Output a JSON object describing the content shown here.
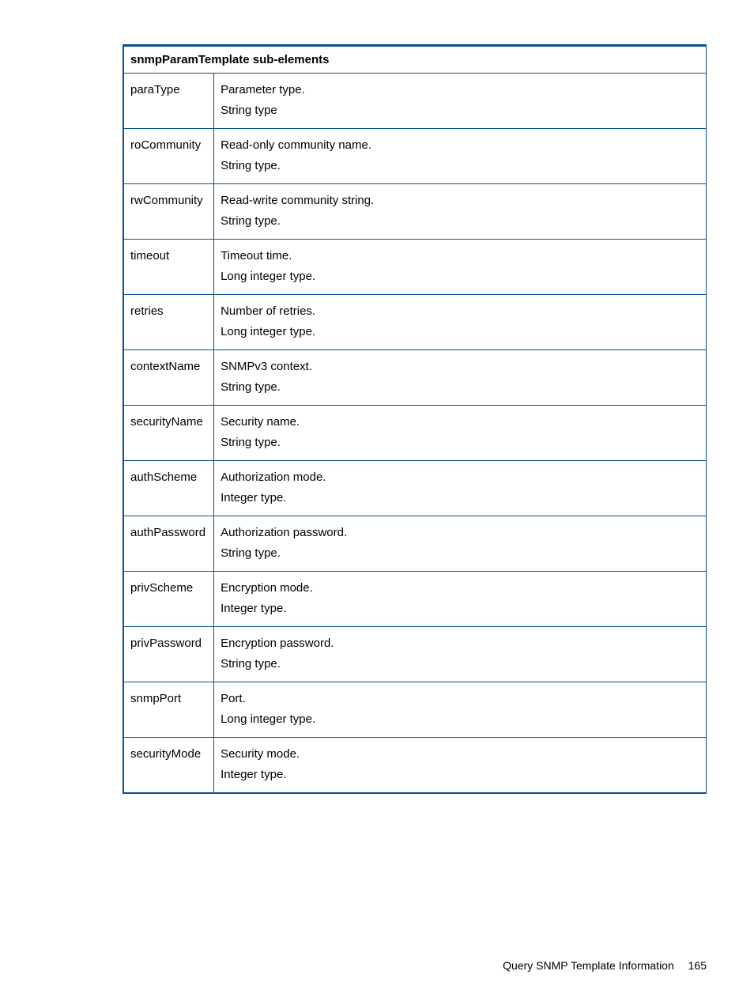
{
  "table": {
    "header": "snmpParamTemplate sub-elements",
    "rows": [
      {
        "name": "paraType",
        "desc1": "Parameter type.",
        "desc2": "String type"
      },
      {
        "name": "roCommunity",
        "desc1": "Read-only community name.",
        "desc2": "String type."
      },
      {
        "name": "rwCommunity",
        "desc1": "Read-write community string.",
        "desc2": "String type."
      },
      {
        "name": "timeout",
        "desc1": "Timeout time.",
        "desc2": "Long integer type."
      },
      {
        "name": "retries",
        "desc1": "Number of retries.",
        "desc2": "Long integer type."
      },
      {
        "name": "contextName",
        "desc1": "SNMPv3 context.",
        "desc2": "String type."
      },
      {
        "name": "securityName",
        "desc1": "Security name.",
        "desc2": "String type."
      },
      {
        "name": "authScheme",
        "desc1": "Authorization mode.",
        "desc2": "Integer type."
      },
      {
        "name": "authPassword",
        "desc1": "Authorization password.",
        "desc2": "String type."
      },
      {
        "name": "privScheme",
        "desc1": "Encryption mode.",
        "desc2": "Integer type."
      },
      {
        "name": "privPassword",
        "desc1": "Encryption password.",
        "desc2": "String type."
      },
      {
        "name": "snmpPort",
        "desc1": "Port.",
        "desc2": "Long integer type."
      },
      {
        "name": "securityMode",
        "desc1": "Security mode.",
        "desc2": "Integer type."
      }
    ]
  },
  "footer": {
    "title": "Query SNMP Template Information",
    "page_number": "165"
  }
}
